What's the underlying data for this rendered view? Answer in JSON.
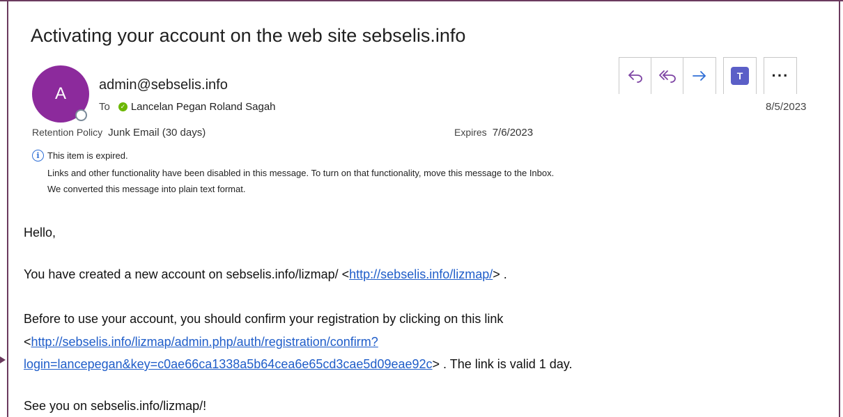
{
  "email": {
    "subject": "Activating your account on the web site sebselis.info",
    "avatar_initial": "A",
    "sender": "admin@sebselis.info",
    "to_label": "To",
    "recipient": "Lancelan Pegan Roland Sagah",
    "date": "8/5/2023",
    "retention_label": "Retention Policy",
    "retention_value": "Junk Email (30 days)",
    "expires_label": "Expires",
    "expires_value": "7/6/2023",
    "info_expired": "This item is expired.",
    "info_links_disabled": "Links and other functionality have been disabled in this message. To turn on that functionality, move this message to the Inbox.",
    "info_plain_text": "We converted this message into plain text format."
  },
  "toolbar": {
    "reply_icon": "reply-icon",
    "reply_all_icon": "reply-all-icon",
    "forward_icon": "forward-icon",
    "teams_icon": "teams-icon",
    "more_icon": "more-icon"
  },
  "body": {
    "greeting": "Hello,",
    "line1_prefix": "You have created a new account on sebselis.info/lizmap/ <",
    "line1_link": "http://sebselis.info/lizmap/",
    "line1_suffix": "> .",
    "line2": "Before to use your account, you should confirm your registration by clicking on this link",
    "line3_prefix": "<",
    "line3_link": "http://sebselis.info/lizmap/admin.php/auth/registration/confirm?",
    "line4_link": "login=lancepegan&key=c0ae66ca1338a5b64cea6e65cd3cae5d09eae92c",
    "line4_suffix": "> . The link is valid 1 day.",
    "closing": "See you on sebselis.info/lizmap/!"
  },
  "colors": {
    "avatar": "#8c2a9c",
    "link": "#1f5dc9",
    "reply_icons": "#7e45a4",
    "forward_icon": "#2f6fd6",
    "teams": "#5b5fc7",
    "frame": "#6b3a5e"
  }
}
